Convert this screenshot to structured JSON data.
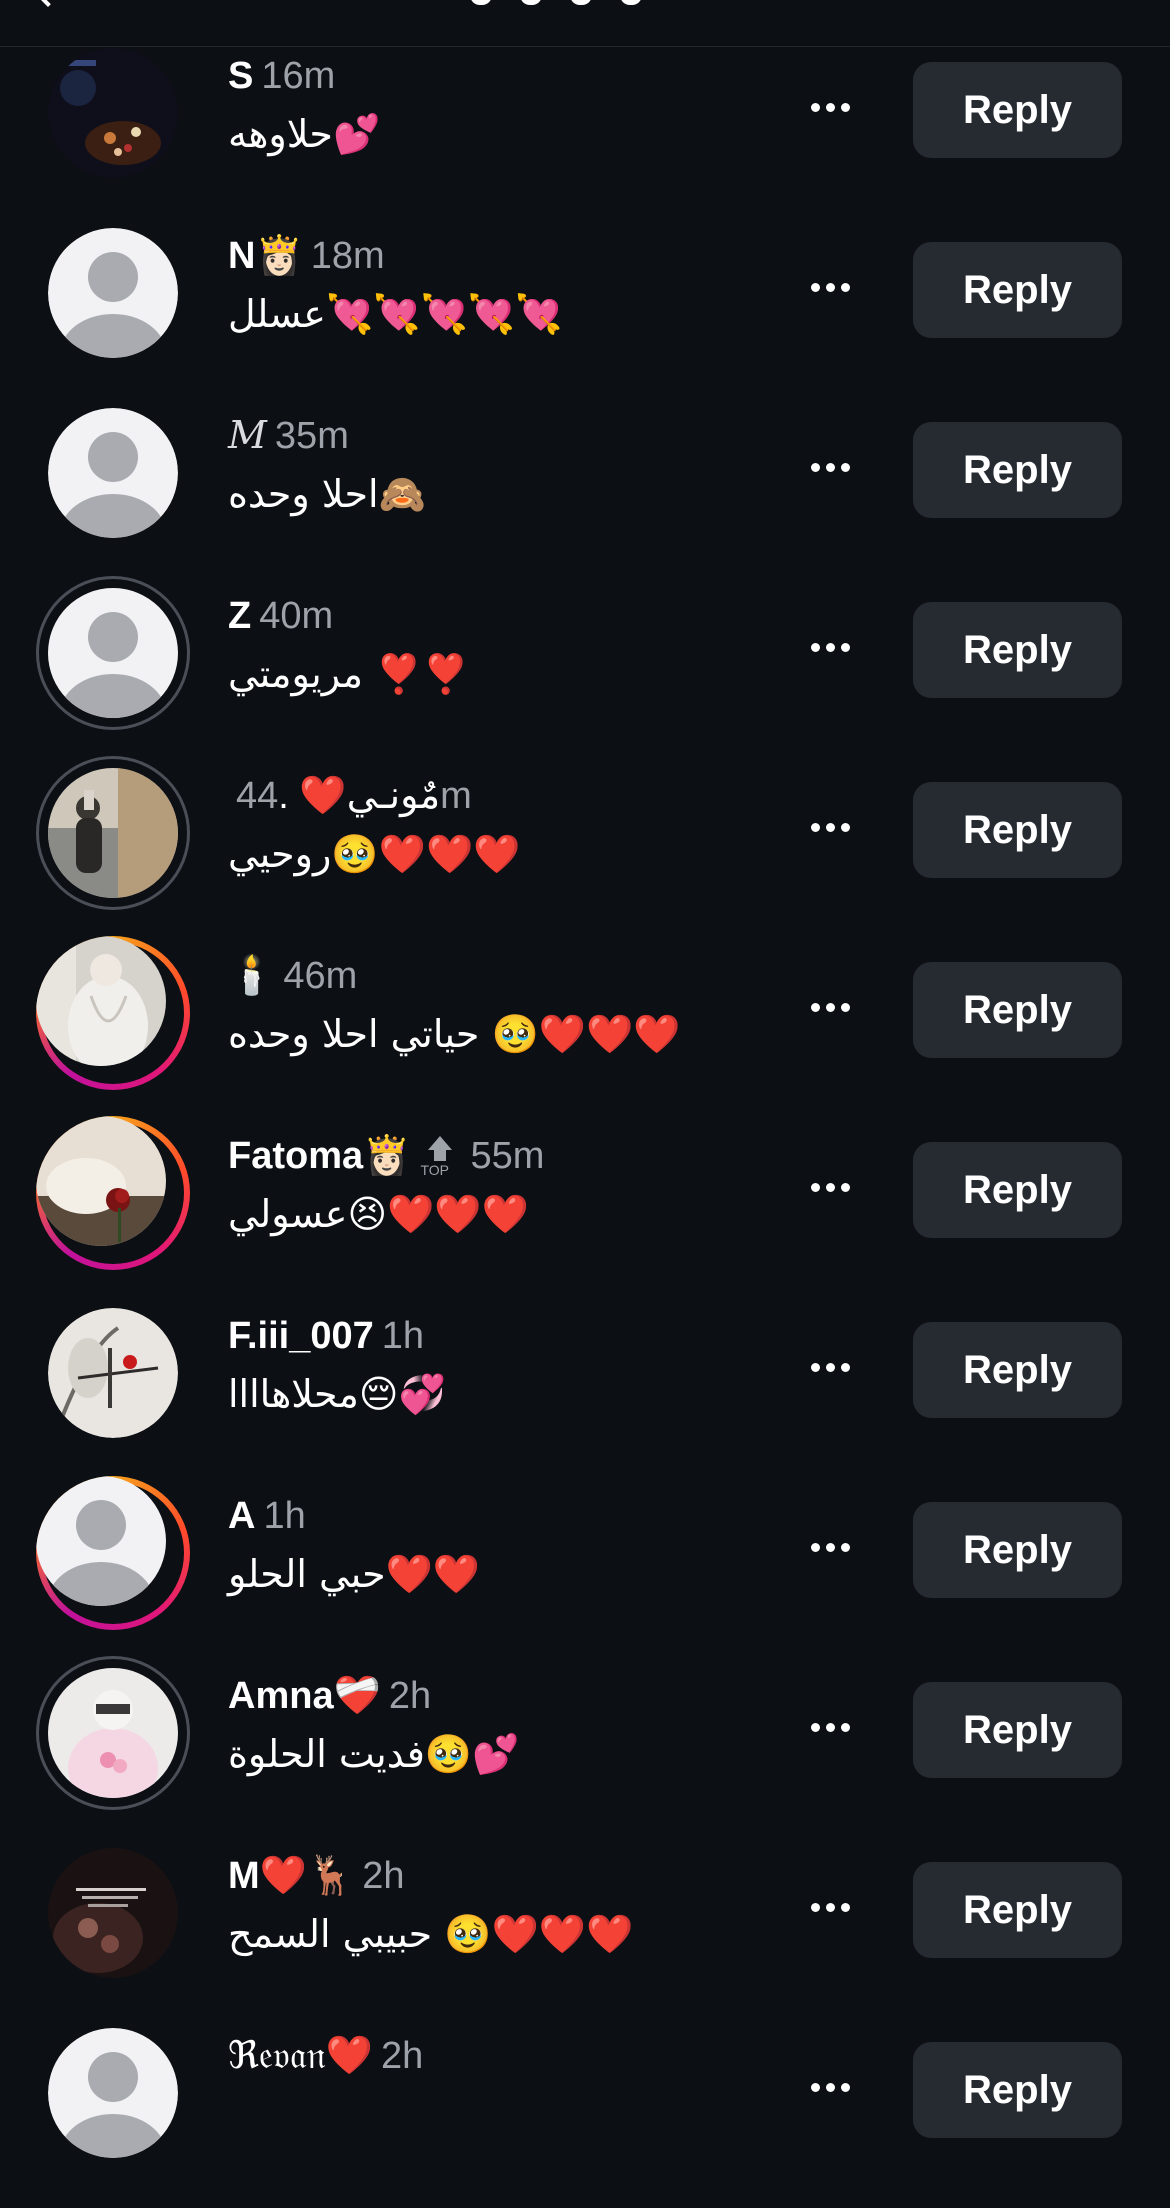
{
  "header": {
    "back_icon": "chevron-left-icon"
  },
  "actions": {
    "more_icon": "ellipsis-icon",
    "reply_label": "Reply"
  },
  "comments": [
    {
      "username": "S",
      "time": "16m",
      "text": "حلاوهه💕",
      "avatar": "photo-dark"
    },
    {
      "username": "N👸🏻",
      "time": "18m",
      "text": "عسلل💘💘💘💘💘",
      "avatar": "default"
    },
    {
      "username": "𝑀",
      "time": "35m",
      "text": "احلا وحده🙈",
      "avatar": "default"
    },
    {
      "username": "Z",
      "time": "40m",
      "text": "مريومتي ❣️❣️",
      "avatar": "default-ring"
    },
    {
      "username": "مٌونـي❤️ .",
      "time": "44m",
      "text": "روحيي🥹❤️❤️❤️",
      "avatar": "photo-mirror"
    },
    {
      "username": "🕯️",
      "time": "46m",
      "text": "حياتي احلا وحده 🥹❤️❤️❤️",
      "avatar": "photo-story-white"
    },
    {
      "username": "Fatoma👸🏻",
      "time": "55m",
      "text": "عسولي😣❤️❤️❤️",
      "avatar": "photo-story-rose",
      "top_badge": "TOP"
    },
    {
      "username": "F.iii_007",
      "time": "1h",
      "text": "محلاهاااا😔💞",
      "avatar": "photo-rose-sketch"
    },
    {
      "username": "A",
      "time": "1h",
      "text": "حبي الحلو❤️❤️",
      "avatar": "default-story"
    },
    {
      "username": "Amna❤️‍🩹",
      "time": "2h",
      "text": "فديت الحلوة🥹💕",
      "avatar": "photo-pink"
    },
    {
      "username": "M❤️🦌",
      "time": "2h",
      "text": "حبيبي السمح 🥹❤️❤️❤️",
      "avatar": "photo-dark-text"
    },
    {
      "username": "ℜ𝔢𝔳𝔞𝔫❤️",
      "time": "2h",
      "text": "",
      "avatar": "default"
    }
  ],
  "colors": {
    "background": "#0c0f14",
    "reply_button": "#262a31",
    "meta_text": "#9ea2a9",
    "default_avatar_bg": "#f2f2f4",
    "default_avatar_fg": "#a9abb0"
  }
}
